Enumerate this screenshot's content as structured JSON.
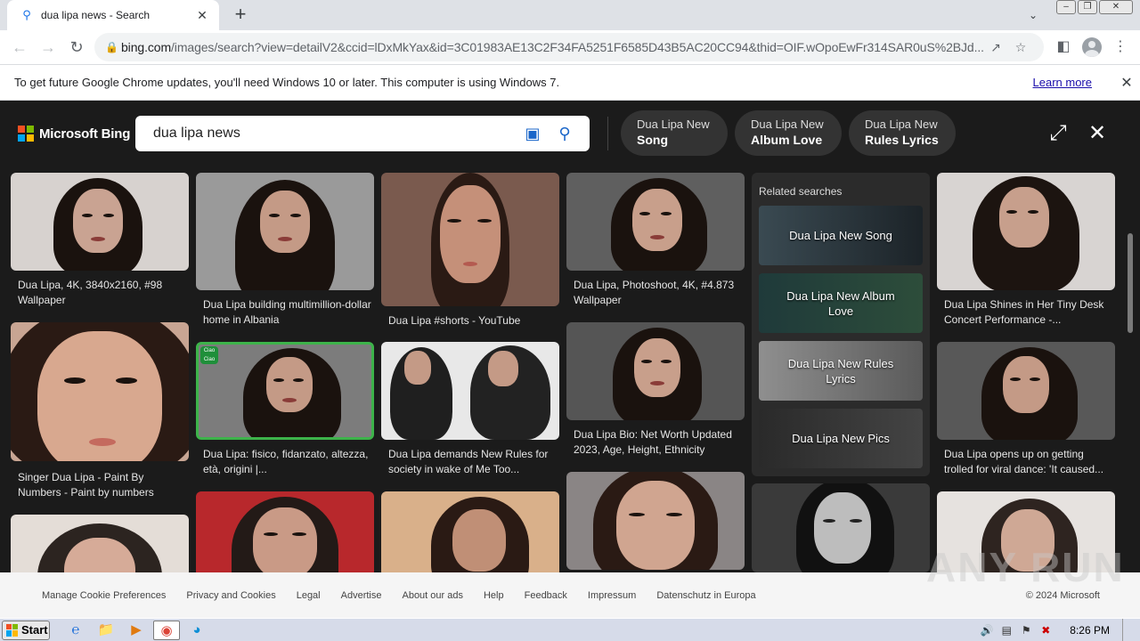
{
  "browser": {
    "tab_title": "dua lipa news - Search",
    "url_host": "bing.com",
    "url_path": "/images/search?view=detailV2&ccid=lDxMkYax&id=3C01983AE13C2F34FA5251F6585D43B5AC20CC94&thid=OIF.wOpoEwFr314SAR0uS%2BJd..."
  },
  "infobar": {
    "message": "To get future Google Chrome updates, you'll need Windows 10 or later. This computer is using Windows 7.",
    "learn_more": "Learn more"
  },
  "bing": {
    "brand": "Microsoft Bing",
    "query": "dua lipa news",
    "chips": [
      {
        "line1": "Dua Lipa New",
        "line2": "Song"
      },
      {
        "line1": "Dua Lipa New",
        "line2": "Album Love"
      },
      {
        "line1": "Dua Lipa New",
        "line2": "Rules Lyrics"
      }
    ]
  },
  "results": {
    "col1": [
      {
        "caption": "Dua Lipa, 4K, 3840x2160, #98 Wallpaper"
      },
      {
        "caption": "Singer Dua Lipa - Paint By Numbers - Paint by numbers"
      }
    ],
    "col2": [
      {
        "caption": "Dua Lipa building multimillion-dollar home in Albania"
      },
      {
        "caption": "Dua Lipa: fisico, fidanzato, altezza, età, origini |..."
      }
    ],
    "col3": [
      {
        "caption": "Dua Lipa #shorts - YouTube"
      },
      {
        "caption": "Dua Lipa demands New Rules for society in wake of Me Too..."
      }
    ],
    "col4": [
      {
        "caption": "Dua Lipa, Photoshoot, 4K, #4.873 Wallpaper"
      },
      {
        "caption": "Dua Lipa Bio: Net Worth Updated 2023, Age, Height, Ethnicity"
      }
    ],
    "col6": [
      {
        "caption": "Dua Lipa Shines in Her Tiny Desk Concert Performance -..."
      },
      {
        "caption": "Dua Lipa opens up on getting trolled for viral dance: 'It caused..."
      }
    ],
    "selected_badge": "Ciao Ciao"
  },
  "related": {
    "title": "Related searches",
    "items": [
      {
        "label": "Dua Lipa New Song"
      },
      {
        "label": "Dua Lipa New Album Love"
      },
      {
        "label": "Dua Lipa New Rules Lyrics"
      },
      {
        "label": "Dua Lipa New Pics"
      }
    ]
  },
  "footer": {
    "links": [
      "Manage Cookie Preferences",
      "Privacy and Cookies",
      "Legal",
      "Advertise",
      "About our ads",
      "Help",
      "Feedback",
      "Impressum",
      "Datenschutz in Europa"
    ],
    "copyright": "© 2024 Microsoft"
  },
  "watermark": "ANY RUN",
  "taskbar": {
    "start": "Start",
    "time": "8:26 PM"
  }
}
